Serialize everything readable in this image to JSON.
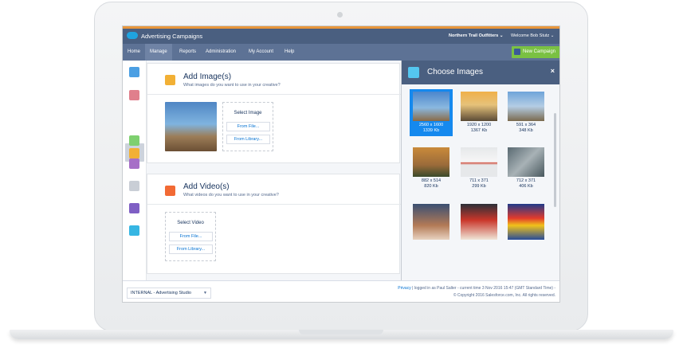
{
  "app": {
    "title": "Advertising Campaigns",
    "org": "Northern Trail Outfitters",
    "welcome": "Welcome Bob Stutz"
  },
  "nav": {
    "tabs": [
      "Home",
      "Manage",
      "Reports",
      "Administration",
      "My Account",
      "Help"
    ],
    "active_tab": "Manage",
    "new_button": "New Campaign"
  },
  "add_images": {
    "title": "Add Image(s)",
    "subtitle": "What images do you want to use in your creative?",
    "select_label": "Select Image",
    "from_file": "From File...",
    "from_library": "From Library..."
  },
  "add_videos": {
    "title": "Add Video(s)",
    "subtitle": "What videos do you want to use in your creative?",
    "select_label": "Select Video",
    "from_file": "From File...",
    "from_library": "From Library..."
  },
  "footer": {
    "select_value": "INTERNAL - Advertising Studio",
    "privacy_link": "Privacy",
    "login_text": " | logged in as Paul Salter - current time 3 Nov 2016 15:47 (GMT Standard Time) -",
    "copyright": "© Copyright 2016 Salesforce.com, Inc. All rights reserved."
  },
  "panel": {
    "title": "Choose Images",
    "close_icon": "×"
  },
  "thumbnails": [
    {
      "dim": "2560 x 1600",
      "size": "1339 Kb",
      "selected": true
    },
    {
      "dim": "1920 x 1200",
      "size": "1367 Kb",
      "selected": false
    },
    {
      "dim": "591 x 364",
      "size": "348 Kb",
      "selected": false
    },
    {
      "dim": "882 x 514",
      "size": "820 Kb",
      "selected": false
    },
    {
      "dim": "711 x 371",
      "size": "299 Kb",
      "selected": false
    },
    {
      "dim": "712 x 371",
      "size": "406 Kb",
      "selected": false
    },
    {
      "dim": "",
      "size": "",
      "selected": false
    },
    {
      "dim": "",
      "size": "",
      "selected": false
    },
    {
      "dim": "",
      "size": "",
      "selected": false
    }
  ],
  "colors": {
    "header": "#4a5f80",
    "nav": "#5d7295",
    "accent_orange": "#e8963b",
    "new_button": "#7ac143",
    "selected_thumb": "#1589ee"
  },
  "rail_icons": [
    "flag-icon",
    "contact-icon",
    "campaign-icon",
    "chat-icon",
    "clock-icon",
    "link-icon",
    "settings-icon",
    "info-icon"
  ]
}
